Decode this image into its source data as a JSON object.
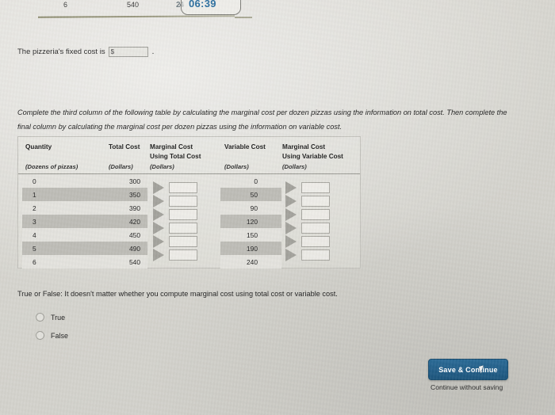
{
  "top_partial_row": {
    "quantity": "6",
    "total_cost": "540",
    "ghost_digits": "24"
  },
  "timer": {
    "value": "06:39",
    "color": "#2b6e9e"
  },
  "fixed_cost": {
    "label": "The pizzeria's fixed cost is",
    "currency_symbol": "$",
    "value": "",
    "placeholder": "",
    "trailing_period": "."
  },
  "instructions": {
    "text": "Complete the third column of the following table by calculating the marginal cost per dozen pizzas using the information on total cost. Then complete the final column by calculating the marginal cost per dozen pizzas using the information on variable cost."
  },
  "table": {
    "headers": [
      {
        "title": "Quantity",
        "unit": "(Dozens of pizzas)"
      },
      {
        "title": "Total Cost",
        "unit": "(Dollars)"
      },
      {
        "title": "Marginal Cost Using Total Cost",
        "unit": "(Dollars)"
      },
      {
        "title": "Variable Cost",
        "unit": "(Dollars)"
      },
      {
        "title": "Marginal Cost Using Variable Cost",
        "unit": "(Dollars)"
      }
    ],
    "header_lines": {
      "quantity": "Quantity",
      "total_cost": "Total Cost",
      "marginal_total_1": "Marginal Cost",
      "marginal_total_2": "Using Total Cost",
      "variable_cost": "Variable Cost",
      "marginal_variable_1": "Marginal Cost",
      "marginal_variable_2": "Using Variable Cost",
      "unit_quantity": "(Dozens of pizzas)",
      "unit_dollars": "(Dollars)"
    },
    "rows": [
      {
        "quantity": "0",
        "total_cost": "300",
        "variable_cost": "0"
      },
      {
        "quantity": "1",
        "total_cost": "350",
        "variable_cost": "50"
      },
      {
        "quantity": "2",
        "total_cost": "390",
        "variable_cost": "90"
      },
      {
        "quantity": "3",
        "total_cost": "420",
        "variable_cost": "120"
      },
      {
        "quantity": "4",
        "total_cost": "450",
        "variable_cost": "150"
      },
      {
        "quantity": "5",
        "total_cost": "490",
        "variable_cost": "190"
      },
      {
        "quantity": "6",
        "total_cost": "540",
        "variable_cost": "240"
      }
    ],
    "marginal_total_inputs": [
      "",
      "",
      "",
      "",
      "",
      ""
    ],
    "marginal_variable_inputs": [
      "",
      "",
      "",
      "",
      "",
      ""
    ]
  },
  "true_false": {
    "question": "True or False: It doesn't matter whether you compute marginal cost using total cost or variable cost.",
    "options": [
      {
        "label": "True",
        "selected": false
      },
      {
        "label": "False",
        "selected": false
      }
    ]
  },
  "footer": {
    "save_label": "Save & Continue",
    "save_color": "#1d557c",
    "continue_without_saving": "Continue without saving"
  }
}
